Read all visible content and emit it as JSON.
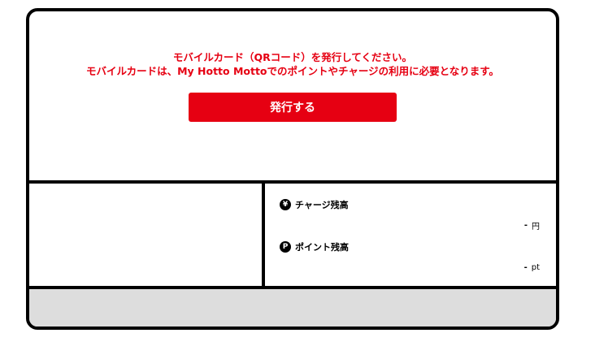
{
  "issue_section": {
    "message_line1": "モバイルカード（QRコード）を発行してください。",
    "message_line2": "モバイルカードは、My Hotto Mottoでのポイントやチャージの利用に必要となります。",
    "issue_button_label": "発行する"
  },
  "balances": {
    "charge": {
      "icon_symbol": "¥",
      "label": "チャージ残高",
      "value": "-",
      "unit": "円"
    },
    "points": {
      "icon_symbol": "P",
      "label": "ポイント残高",
      "value": "-",
      "unit": "pt"
    }
  },
  "colors": {
    "accent_red": "#e60012",
    "footer_gray": "#dddddd"
  }
}
